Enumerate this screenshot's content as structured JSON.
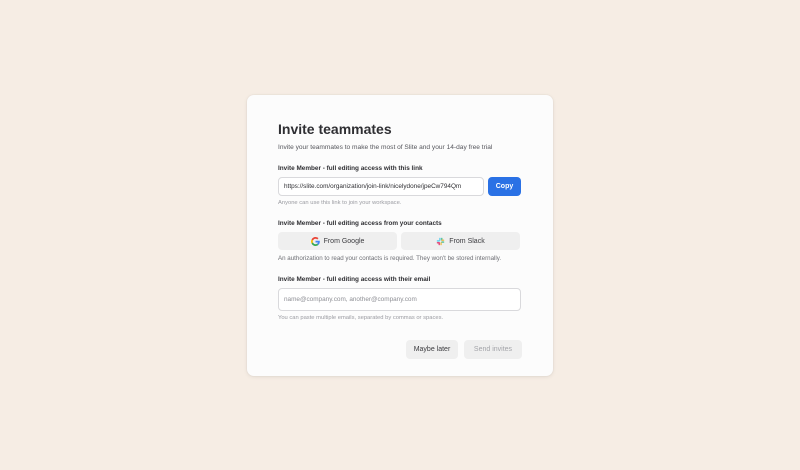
{
  "modal": {
    "title": "Invite teammates",
    "subtitle": "Invite your teammates to make the most of Slite and your 14-day free trial"
  },
  "link_section": {
    "label": "Invite Member - full editing access with this link",
    "link_value": "https://slite.com/organization/join-link/nicelydone/jpeCw794Qm",
    "copy_label": "Copy",
    "hint": "Anyone can use this link to join your workspace."
  },
  "contacts_section": {
    "label": "Invite Member - full editing access from your contacts",
    "google_label": "From Google",
    "google_icon": "google-icon",
    "slack_label": "From Slack",
    "slack_icon": "slack-icon",
    "note": "An authorization to read your contacts is required. They won't be stored internally."
  },
  "email_section": {
    "label": "Invite Member - full editing access with their email",
    "placeholder": "name@company.com, another@company.com",
    "hint": "You can paste multiple emails, separated by commas or spaces."
  },
  "actions": {
    "maybe_later_label": "Maybe later",
    "send_invites_label": "Send invites"
  },
  "colors": {
    "background": "#f6ede4",
    "primary": "#2a71e5",
    "google_blue": "#4285f4",
    "google_red": "#ea4335",
    "google_yellow": "#fbbc05",
    "google_green": "#34a853",
    "slack_cyan": "#36c5f0",
    "slack_green": "#2eb67d",
    "slack_yellow": "#ecb22e",
    "slack_red": "#e01e5a"
  }
}
